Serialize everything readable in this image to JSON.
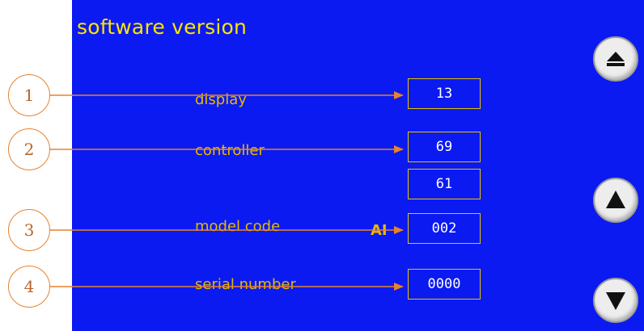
{
  "screen": {
    "title": "software version",
    "background_color": "#0b1af0",
    "label_color": "#e8b800",
    "box_border_color": "#e6c400"
  },
  "fields": {
    "display": {
      "label": "display",
      "value": "13"
    },
    "controller": {
      "label": "controller",
      "value": "69",
      "value2": "61"
    },
    "model_code": {
      "label": "model code",
      "prefix": "AI",
      "value": "002"
    },
    "serial_number": {
      "label": "serial number",
      "value": "0000"
    }
  },
  "buttons": {
    "eject": {
      "icon": "eject-icon"
    },
    "up": {
      "icon": "up-arrow-icon"
    },
    "down": {
      "icon": "down-arrow-icon"
    }
  },
  "callouts": [
    "1",
    "2",
    "3",
    "4"
  ],
  "annotation_color": "#e8822c"
}
